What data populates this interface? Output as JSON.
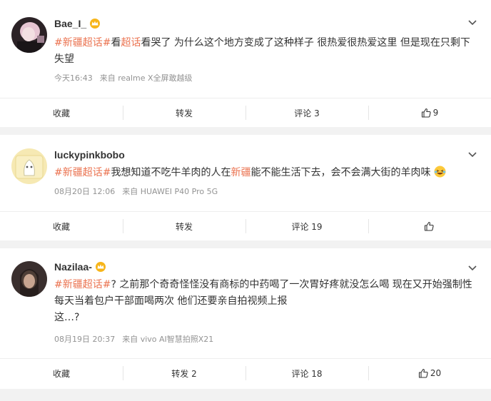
{
  "posts": [
    {
      "username": "Bae_I_",
      "text_parts": [
        {
          "t": "#新疆超话#",
          "c": "tag"
        },
        {
          "t": "看",
          "c": ""
        },
        {
          "t": "超话",
          "c": "link"
        },
        {
          "t": "看哭了 为什么这个地方变成了这种样子 很热爱很热爱这里 但是现在只剩下失望",
          "c": ""
        }
      ],
      "time": "今天16:43",
      "source": "来自 realme X全屏敢越级",
      "actions": {
        "collect": "收藏",
        "repost": "转发",
        "comment": "评论 3",
        "like": "9"
      }
    },
    {
      "username": "luckypinkbobo",
      "text_parts": [
        {
          "t": "#新疆超话#",
          "c": "tag"
        },
        {
          "t": "我想知道不吃牛羊肉的人在",
          "c": ""
        },
        {
          "t": "新疆",
          "c": "link"
        },
        {
          "t": "能不能生活下去，会不会满大街的羊肉味",
          "c": ""
        }
      ],
      "time": "08月20日 12:06",
      "source": "来自 HUAWEI P40 Pro 5G",
      "actions": {
        "collect": "收藏",
        "repost": "转发",
        "comment": "评论 19",
        "like": ""
      }
    },
    {
      "username": "Nazilaa-",
      "text_parts": [
        {
          "t": "#新疆超话#",
          "c": "tag"
        },
        {
          "t": "? 之前那个奇奇怪怪没有商标的中药喝了一次胃好疼就没怎么喝 现在又开始强制性每天当着包户干部面喝两次 他们还要亲自拍视频上报",
          "c": ""
        }
      ],
      "extra_line": "这…?",
      "time": "08月19日 20:37",
      "source": "来自 vivo AI智慧拍照X21",
      "actions": {
        "collect": "收藏",
        "repost": "转发 2",
        "comment": "评论 18",
        "like": "20"
      }
    }
  ],
  "colors": {
    "accent": "#eb7350",
    "meta": "#939393",
    "background": "#f2f2f2"
  }
}
